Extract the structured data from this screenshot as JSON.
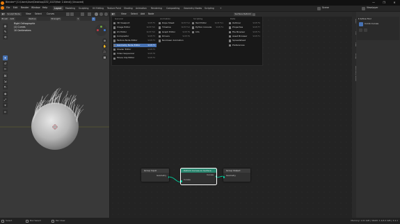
{
  "window": {
    "title": "Blender* [C:\\Users\\User\\Desktop\\ZZZ_2023\\Hair 2.blend] (Unsaved)",
    "controls": [
      "—",
      "❐",
      "✕"
    ]
  },
  "menubar": {
    "menus": [
      "File",
      "Edit",
      "Render",
      "Window",
      "Help"
    ],
    "workspaces": [
      "Layout",
      "Modeling",
      "Sculpting",
      "UV Editing",
      "Texture Paint",
      "Shading",
      "Animation",
      "Rendering",
      "Compositing",
      "Geometry Nodes",
      "Scripting"
    ],
    "active_workspace": "Layout",
    "scene_label": "Scene",
    "view_layer_label": "ViewLayer"
  },
  "viewport": {
    "mode": "Sculpt Mode",
    "header_menus": [
      "View",
      "Select",
      "Curves"
    ],
    "header2_items": [
      "Brush",
      "Add",
      "Radius",
      "Strength"
    ],
    "overlay": {
      "view": "Right Orthographic",
      "object": "(1) Curves",
      "units": "10 Centimeters"
    },
    "tools": [
      "◍",
      "✎",
      "⟲",
      "✦",
      "↺",
      "✂",
      "⌘",
      "⇲",
      "⇱",
      "✜",
      "⤢",
      "⌖",
      "✑"
    ],
    "active_tool_index": 3,
    "nav_buttons": [
      "⊕",
      "✋",
      "🎥",
      "▦"
    ]
  },
  "node_editor": {
    "header_menus": [
      "View",
      "Select",
      "Add",
      "Node"
    ],
    "tree_name": "Surface Deform",
    "add_menu": {
      "columns": [
        {
          "title": "General",
          "items": [
            {
              "label": "3D Viewport",
              "shortcut": "Shift F5"
            },
            {
              "label": "Image Editor",
              "shortcut": "Shift F10"
            },
            {
              "label": "UV Editor",
              "shortcut": "Shift F10"
            },
            {
              "label": "Compositor",
              "shortcut": "Shift F3"
            },
            {
              "label": "Texture Node Editor",
              "shortcut": "Shift F3"
            },
            {
              "label": "Geometry Node Editor",
              "shortcut": "Shift F3"
            },
            {
              "label": "Shader Editor",
              "shortcut": "Shift F3"
            },
            {
              "label": "Video Sequencer",
              "shortcut": "Shift F8"
            },
            {
              "label": "Movie Clip Editor",
              "shortcut": "Shift F2"
            }
          ],
          "highlight_index": 5
        },
        {
          "title": "Animation",
          "items": [
            {
              "label": "Dope Sheet",
              "shortcut": "Shift F12"
            },
            {
              "label": "Timeline",
              "shortcut": "Shift F12"
            },
            {
              "label": "Graph Editor",
              "shortcut": "Shift F6"
            },
            {
              "label": "Drivers",
              "shortcut": "Shift F6"
            },
            {
              "label": "Nonlinear Animation",
              "shortcut": ""
            }
          ]
        },
        {
          "title": "Scripting",
          "items": [
            {
              "label": "Text Editor",
              "shortcut": "Shift F11"
            },
            {
              "label": "Python Console",
              "shortcut": "Shift F4"
            },
            {
              "label": "Info",
              "shortcut": ""
            }
          ]
        },
        {
          "title": "Data",
          "items": [
            {
              "label": "Outliner",
              "shortcut": "Shift F9"
            },
            {
              "label": "Properties",
              "shortcut": "Shift F7"
            },
            {
              "label": "File Browser",
              "shortcut": "Shift F1"
            },
            {
              "label": "Asset Browser",
              "shortcut": "Shift F1"
            },
            {
              "label": "Spreadsheet",
              "shortcut": ""
            },
            {
              "label": "Preferences",
              "shortcut": ""
            }
          ]
        }
      ]
    },
    "nodes": {
      "group_input": {
        "title": "Group Input",
        "socket": "Geometry"
      },
      "deform": {
        "title": "Deform Curves on Surface",
        "in": "Curves",
        "out": "Curves"
      },
      "group_output": {
        "title": "Group Output",
        "socket": "Geometry"
      }
    }
  },
  "properties": {
    "vertical_tabs": [
      "Node",
      "Tool",
      "View",
      "Group",
      "Geometry Nodes"
    ],
    "section": "Active Tool",
    "tool_name": "Comb Curves"
  },
  "statusbar": {
    "left": [
      "Select",
      "Box Select",
      "Pan View"
    ],
    "right": "Memory: 1.01 GiB | VRAM: 1.4/4.0 GiB | 3.4.1"
  }
}
